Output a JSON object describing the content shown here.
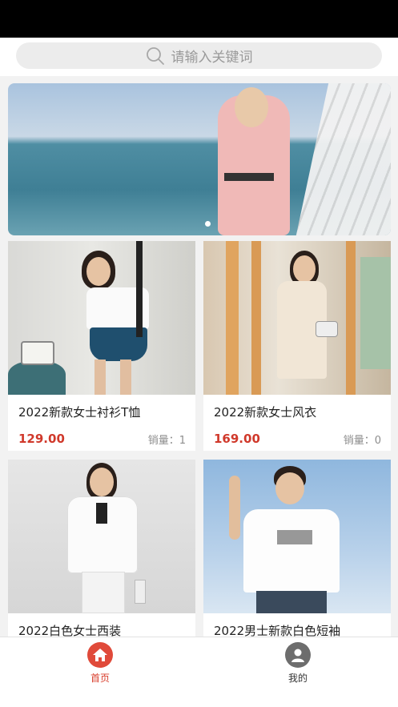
{
  "search": {
    "placeholder": "请输入关键词",
    "icon": "search-icon"
  },
  "banner": {
    "dot_count": 1,
    "active_index": 0
  },
  "products": [
    {
      "title": "2022新款女士衬衫T恤",
      "price": "129.00",
      "sales": "销量：1"
    },
    {
      "title": "2022新款女士风衣",
      "price": "169.00",
      "sales": "销量：0"
    },
    {
      "title": "2022白色女士西装",
      "price": "",
      "sales": ""
    },
    {
      "title": "2022男士新款白色短袖",
      "price": "",
      "sales": ""
    }
  ],
  "tabbar": {
    "items": [
      {
        "label": "首页",
        "icon": "home-icon",
        "active": true
      },
      {
        "label": "我的",
        "icon": "user-icon",
        "active": false
      }
    ]
  },
  "colors": {
    "price": "#d0392b",
    "active_tab": "#d9402f"
  }
}
